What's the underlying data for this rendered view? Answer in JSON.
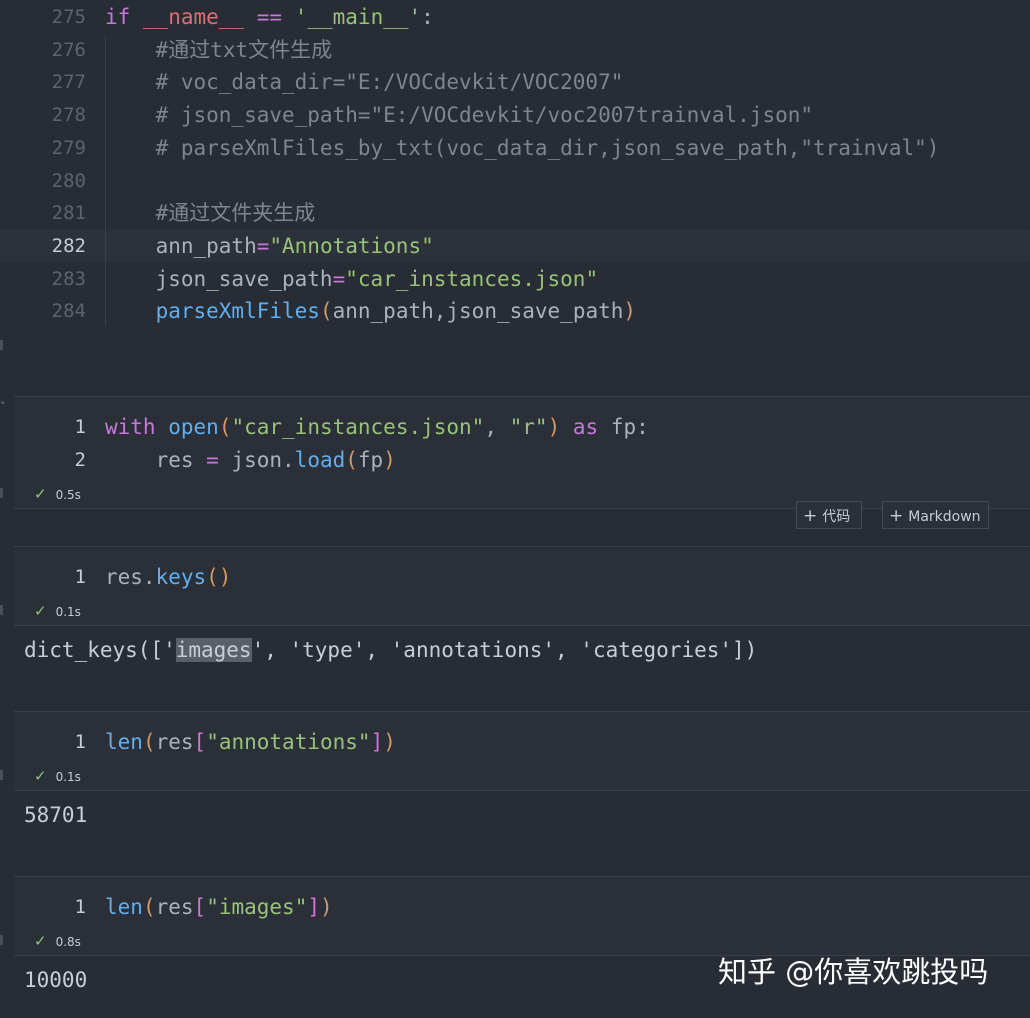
{
  "editor_cell": {
    "lines": [
      {
        "num": "275",
        "parts": [
          [
            "kw",
            "if"
          ],
          [
            "t",
            " "
          ],
          [
            "dunder",
            "__name__"
          ],
          [
            "t",
            " "
          ],
          [
            "kw",
            "=="
          ],
          [
            "t",
            " "
          ],
          [
            "str",
            "'__main__'"
          ],
          [
            "t",
            ":"
          ]
        ]
      },
      {
        "num": "276",
        "parts": [
          [
            "cmt",
            "    #通过txt文件生成"
          ]
        ]
      },
      {
        "num": "277",
        "parts": [
          [
            "cmt",
            "    # voc_data_dir=\"E:/VOCdevkit/VOC2007\""
          ]
        ]
      },
      {
        "num": "278",
        "parts": [
          [
            "cmt",
            "    # json_save_path=\"E:/VOCdevkit/voc2007trainval.json\""
          ]
        ]
      },
      {
        "num": "279",
        "parts": [
          [
            "cmt",
            "    # parseXmlFiles_by_txt(voc_data_dir,json_save_path,\"trainval\")"
          ]
        ]
      },
      {
        "num": "280",
        "parts": []
      },
      {
        "num": "281",
        "parts": [
          [
            "cmt",
            "    #通过文件夹生成"
          ]
        ]
      },
      {
        "num": "282",
        "parts": [
          [
            "t",
            "    ann_path"
          ],
          [
            "kw",
            "="
          ],
          [
            "str",
            "\"Annotations\""
          ]
        ]
      },
      {
        "num": "283",
        "parts": [
          [
            "t",
            "    json_save_path"
          ],
          [
            "kw",
            "="
          ],
          [
            "str",
            "\"car_instances.json\""
          ]
        ]
      },
      {
        "num": "284",
        "parts": [
          [
            "t",
            "    "
          ],
          [
            "fn",
            "parseXmlFiles"
          ],
          [
            "pr1",
            "("
          ],
          [
            "t",
            "ann_path,json_save_path"
          ],
          [
            "pr1",
            ")"
          ]
        ]
      }
    ],
    "active_line": "282"
  },
  "cells": [
    {
      "lines": [
        {
          "num": "1",
          "parts": [
            [
              "kw",
              "with"
            ],
            [
              "t",
              " "
            ],
            [
              "fn",
              "open"
            ],
            [
              "pr1",
              "("
            ],
            [
              "str",
              "\"car_instances.json\""
            ],
            [
              "t",
              ", "
            ],
            [
              "str",
              "\"r\""
            ],
            [
              "pr1",
              ")"
            ],
            [
              "t",
              " "
            ],
            [
              "kw",
              "as"
            ],
            [
              "t",
              " fp:"
            ]
          ]
        },
        {
          "num": "2",
          "parts": [
            [
              "t",
              "    res "
            ],
            [
              "kw",
              "="
            ],
            [
              "t",
              " json."
            ],
            [
              "fn",
              "load"
            ],
            [
              "pr1",
              "("
            ],
            [
              "t",
              "fp"
            ],
            [
              "pr1",
              ")"
            ]
          ]
        }
      ],
      "status": "0.5s",
      "output": ""
    },
    {
      "lines": [
        {
          "num": "1",
          "parts": [
            [
              "t",
              "res."
            ],
            [
              "fn",
              "keys"
            ],
            [
              "pr1",
              "()"
            ]
          ]
        }
      ],
      "status": "0.1s",
      "output_parts": [
        [
          "t",
          "dict_keys(['"
        ],
        [
          "hl",
          "images"
        ],
        [
          "t",
          "', 'type', 'annotations', 'categories'])"
        ]
      ]
    },
    {
      "lines": [
        {
          "num": "1",
          "parts": [
            [
              "fn",
              "len"
            ],
            [
              "pr1",
              "("
            ],
            [
              "t",
              "res"
            ],
            [
              "pr2",
              "["
            ],
            [
              "str",
              "\"annotations\""
            ],
            [
              "pr2",
              "]"
            ],
            [
              "pr1",
              ")"
            ]
          ]
        }
      ],
      "status": "0.1s",
      "output": "58701"
    },
    {
      "lines": [
        {
          "num": "1",
          "parts": [
            [
              "fn",
              "len"
            ],
            [
              "pr1",
              "("
            ],
            [
              "t",
              "res"
            ],
            [
              "pr2",
              "["
            ],
            [
              "str",
              "\"images\""
            ],
            [
              "pr2",
              "]"
            ],
            [
              "pr1",
              ")"
            ]
          ]
        }
      ],
      "status": "0.8s",
      "output": "10000"
    }
  ],
  "toolbar": {
    "add_code_label": "代码",
    "add_markdown_label": "Markdown",
    "plus_icon": "+"
  },
  "status_icon": "✓",
  "collapse_icon": "˅",
  "watermark": "知乎 @你喜欢跳投吗"
}
